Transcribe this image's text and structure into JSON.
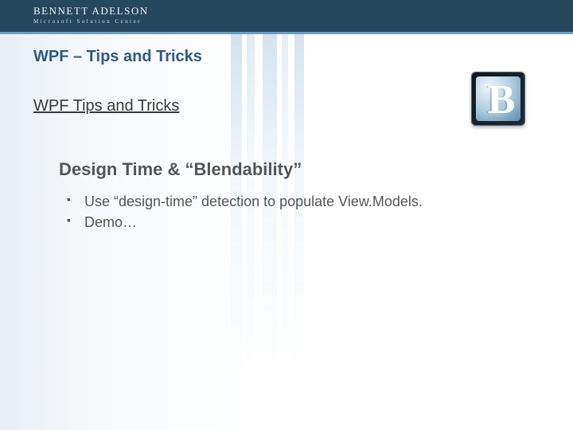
{
  "brand": {
    "name": "BENNETT ADELSON",
    "tagline": "Microsoft Solution Center"
  },
  "header": {
    "title": "WPF – Tips and Tricks"
  },
  "subtitle": "WPF Tips and Tricks",
  "badge": {
    "letter": "B"
  },
  "section": {
    "title": "Design Time & “Blendability”",
    "bullets": [
      "Use “design-time” detection to populate View.Models.",
      "Demo…"
    ]
  }
}
